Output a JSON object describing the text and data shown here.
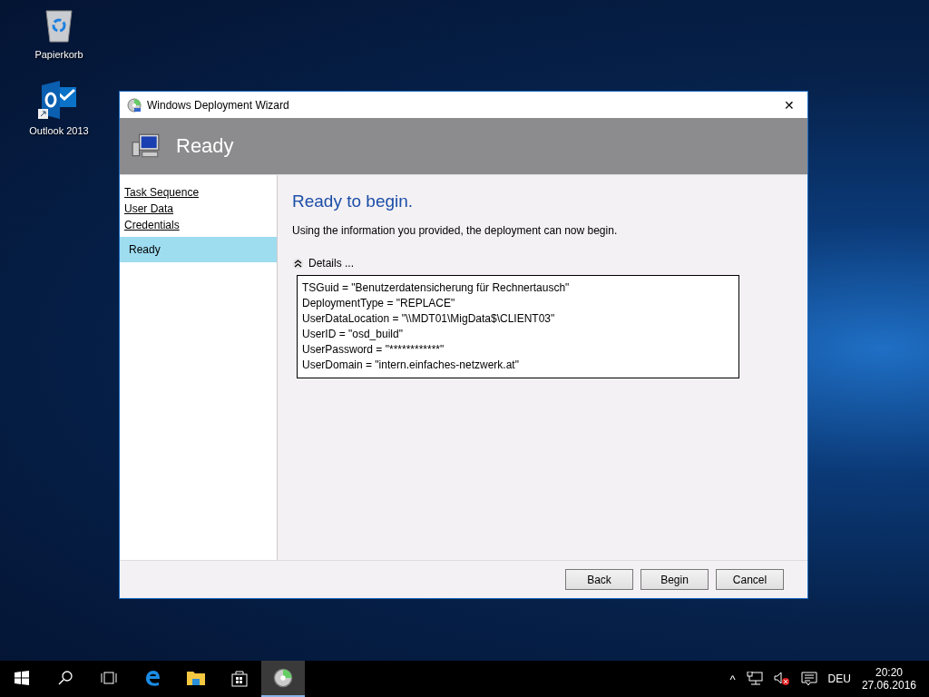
{
  "desktop_icons": [
    {
      "kind": "recycle",
      "label": "Papierkorb"
    },
    {
      "kind": "outlook",
      "label": "Outlook 2013"
    }
  ],
  "window": {
    "title": "Windows Deployment Wizard",
    "close": "✕",
    "header": "Ready"
  },
  "sidebar": {
    "items": [
      {
        "label": "Task Sequence",
        "selected": false
      },
      {
        "label": "User Data",
        "selected": false
      },
      {
        "label": "Credentials",
        "selected": false
      },
      {
        "label": "Ready",
        "selected": true
      }
    ]
  },
  "content": {
    "heading": "Ready to begin.",
    "text": "Using the information you provided, the deployment can now begin.",
    "details": {
      "label": "Details ...",
      "expanded": true,
      "lines": [
        "TSGuid = \"Benutzerdatensicherung für Rechnertausch\"",
        "DeploymentType = \"REPLACE\"",
        "UserDataLocation = \"\\\\MDT01\\MigData$\\CLIENT03\"",
        "UserID = \"osd_build\"",
        "UserPassword = \"************\"",
        "UserDomain = \"intern.einfaches-netzwerk.at\""
      ]
    }
  },
  "buttons": [
    {
      "label": "Back",
      "default": false
    },
    {
      "label": "Begin",
      "default": false
    },
    {
      "label": "Cancel",
      "default": false
    }
  ],
  "taskbar": {
    "apps": [
      {
        "kind": "start",
        "active": false
      },
      {
        "kind": "search",
        "active": false
      },
      {
        "kind": "taskview",
        "active": false
      },
      {
        "kind": "edge",
        "active": false
      },
      {
        "kind": "explorer",
        "active": false
      },
      {
        "kind": "store",
        "active": false
      },
      {
        "kind": "wizard",
        "active": true
      }
    ],
    "tray": {
      "chevron": "^",
      "language": "DEU",
      "time": "20:20",
      "date": "27.06.2016"
    }
  }
}
